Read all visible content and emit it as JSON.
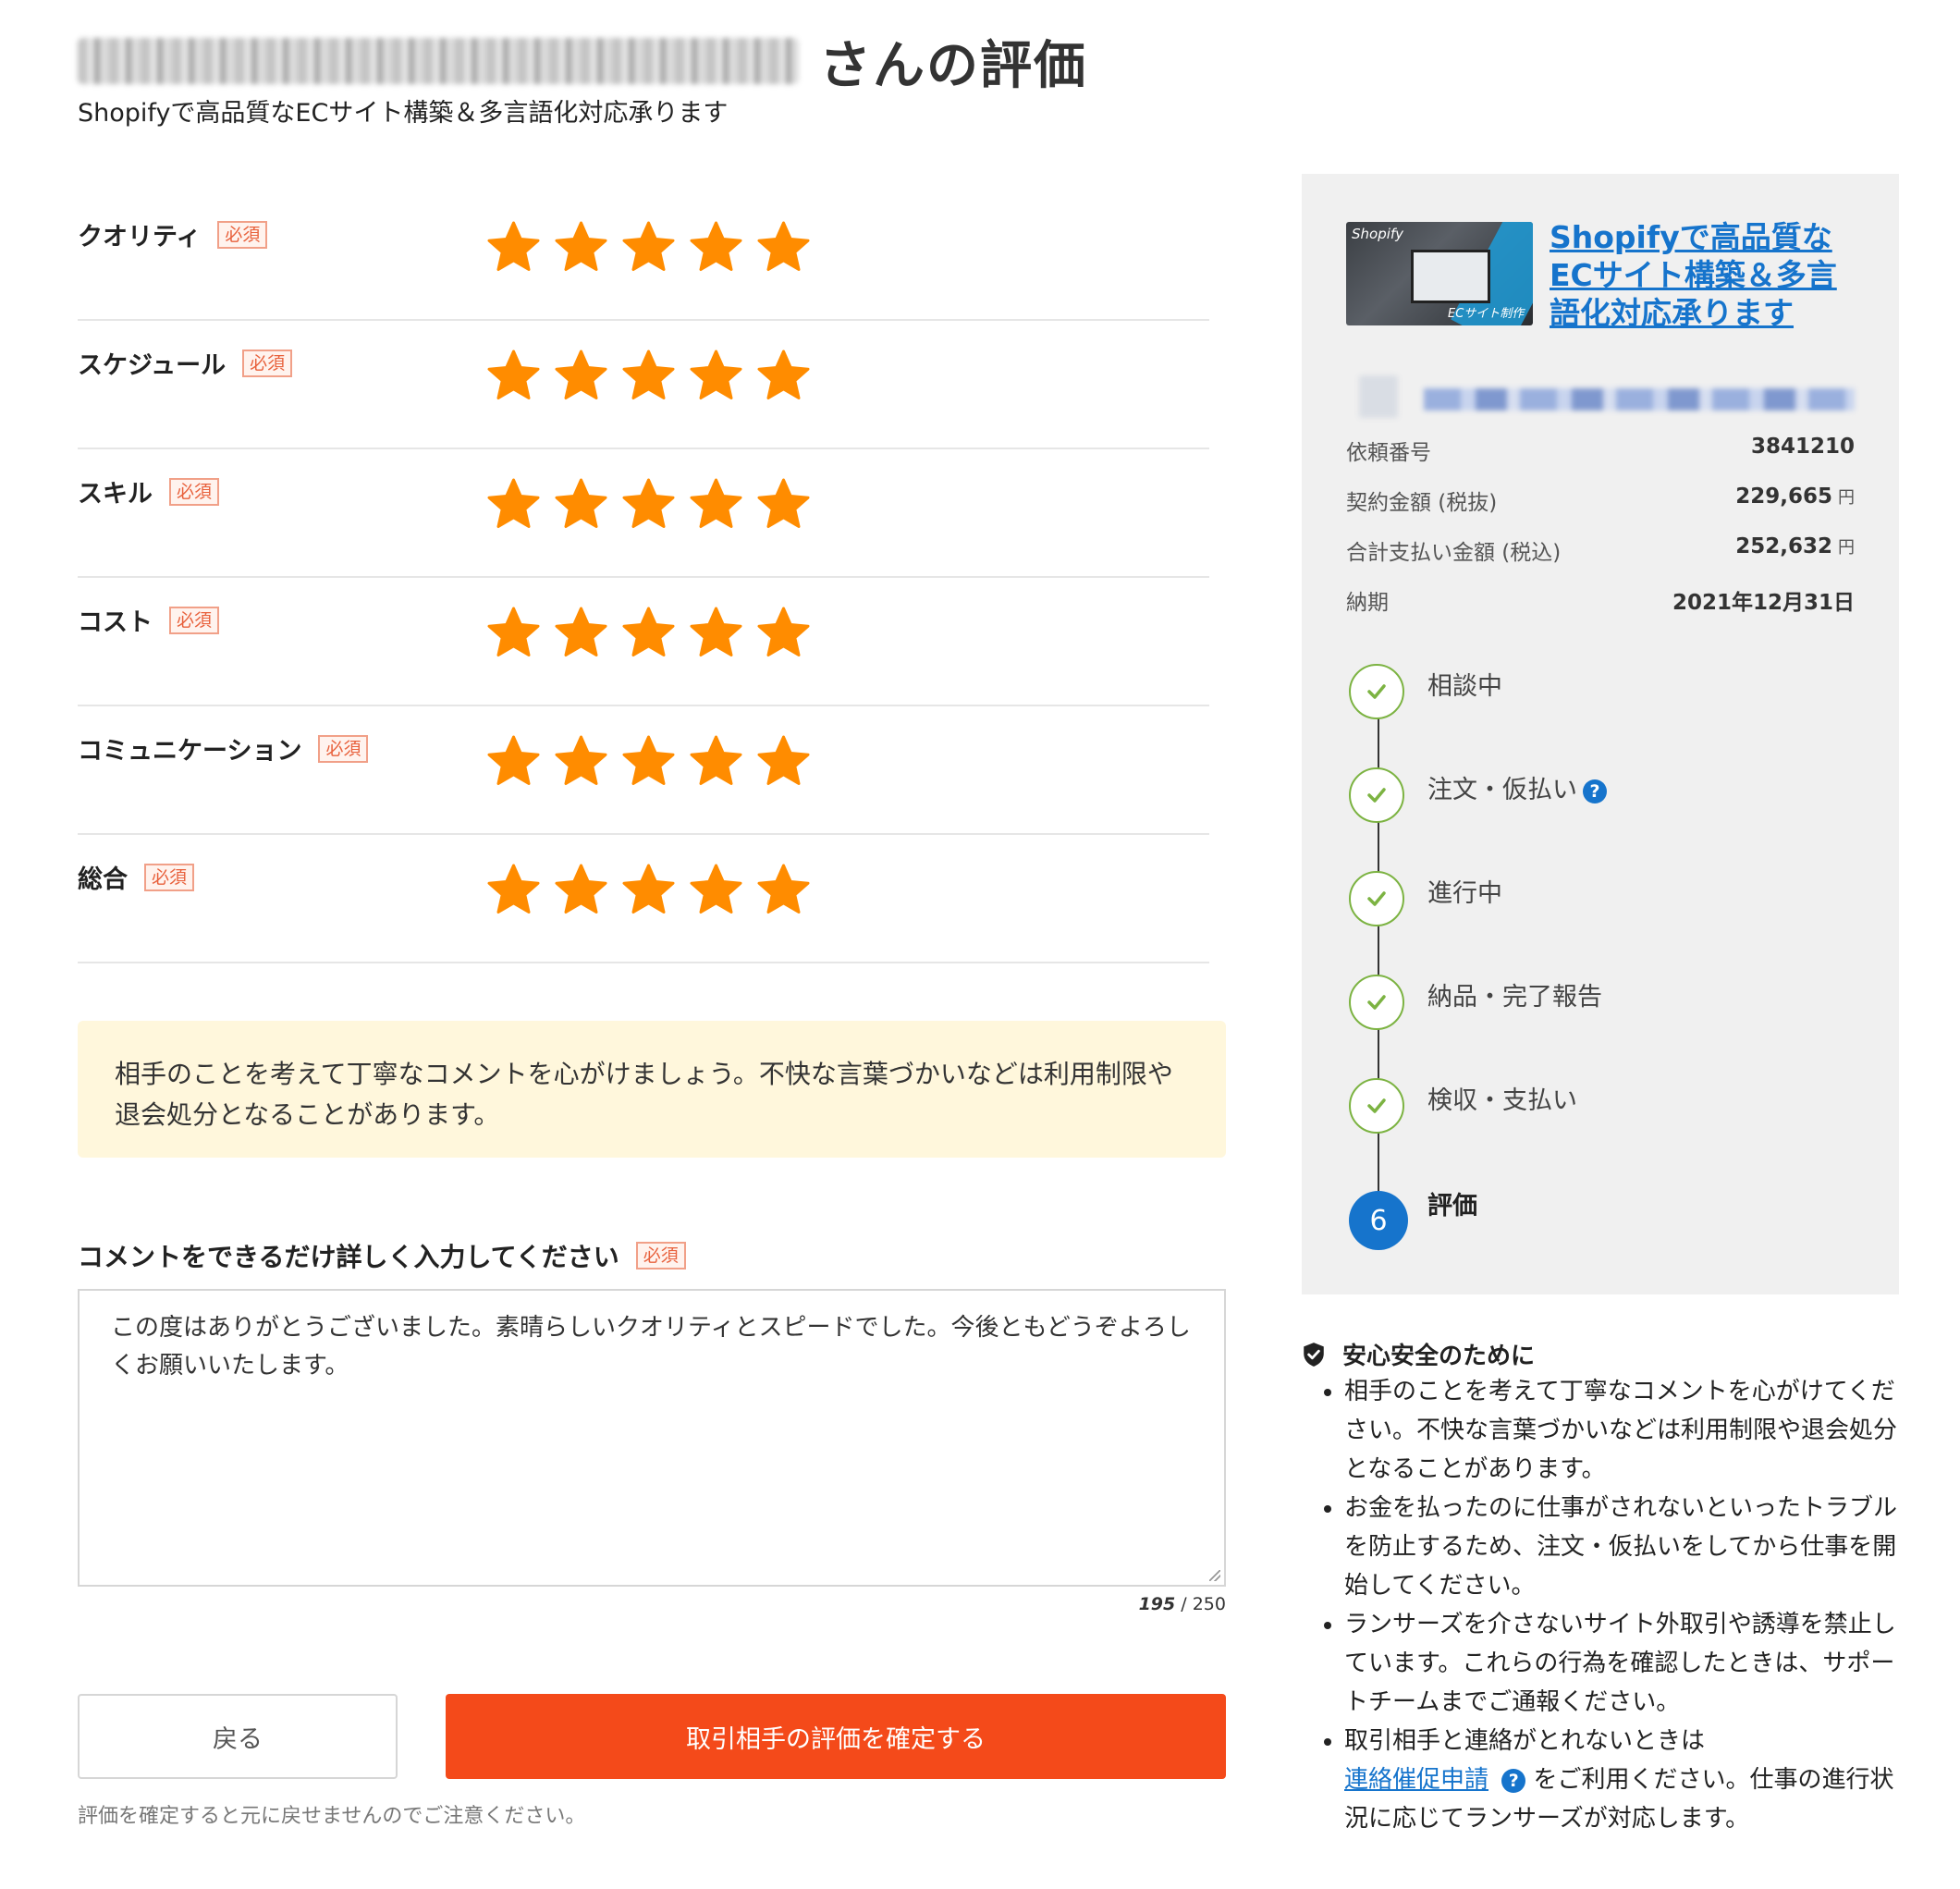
{
  "header": {
    "title_suffix": "さんの評価",
    "subtitle": "Shopifyで高品質なECサイト構築＆多言語化対応承ります"
  },
  "required_badge": "必須",
  "ratings": [
    {
      "label": "クオリティ",
      "stars": 5,
      "max": 5
    },
    {
      "label": "スケジュール",
      "stars": 5,
      "max": 5
    },
    {
      "label": "スキル",
      "stars": 5,
      "max": 5
    },
    {
      "label": "コスト",
      "stars": 5,
      "max": 5
    },
    {
      "label": "コミュニケーション",
      "stars": 5,
      "max": 5
    },
    {
      "label": "総合",
      "stars": 5,
      "max": 5
    }
  ],
  "notice": "相手のことを考えて丁寧なコメントを心がけましょう。不快な言葉づかいなどは利用制限や退会処分となることがあります。",
  "comment": {
    "label": "コメントをできるだけ詳しく入力してください",
    "value": "この度はありがとうございました。素晴らしいクオリティとスピードでした。今後ともどうぞよろしくお願いいたします。",
    "count": "195",
    "max": "/ 250"
  },
  "buttons": {
    "back": "戻る",
    "confirm": "取引相手の評価を確定する"
  },
  "footnote": "評価を確定すると元に戻せませんのでご注意ください。",
  "sidebar": {
    "thumb_text_top": "Shopify",
    "thumb_text_bottom": "ECサイト制作",
    "service_title": "Shopifyで高品質なECサイト構築＆多言語化対応承ります",
    "info": [
      {
        "key": "依頼番号",
        "value": "3841210",
        "unit": ""
      },
      {
        "key": "契約金額 (税抜)",
        "value": "229,665",
        "unit": "円"
      },
      {
        "key": "合計支払い金額 (税込)",
        "value": "252,632",
        "unit": "円"
      },
      {
        "key": "納期",
        "value": "2021年12月31日",
        "unit": ""
      }
    ],
    "steps": [
      {
        "label": "相談中"
      },
      {
        "label": "注文・仮払い"
      },
      {
        "label": "進行中"
      },
      {
        "label": "納品・完了報告"
      },
      {
        "label": "検収・支払い"
      },
      {
        "label": "評価",
        "number": "6"
      }
    ]
  },
  "safety": {
    "title": "安心安全のために",
    "items": [
      "相手のことを考えて丁寧なコメントを心がけてください。不快な言葉づかいなどは利用制限や退会処分となることがあります。",
      "お金を払ったのに仕事がされないといったトラブルを防止するため、注文・仮払いをしてから仕事を開始してください。",
      "ランサーズを介さないサイト外取引や誘導を禁止しています。これらの行為を確認したときは、サポートチームまでご通報ください。"
    ],
    "last_item_prefix": "取引相手と連絡がとれないときは",
    "last_item_link": "連絡催促申請",
    "last_item_suffix": "をご利用ください。仕事の進行状況に応じてランサーズが対応します。"
  },
  "colors": {
    "star": "#ff8c00",
    "primary_button": "#f44a1a",
    "link": "#1674cc",
    "notice_bg": "#fff7dc",
    "step_check": "#7cb342"
  }
}
